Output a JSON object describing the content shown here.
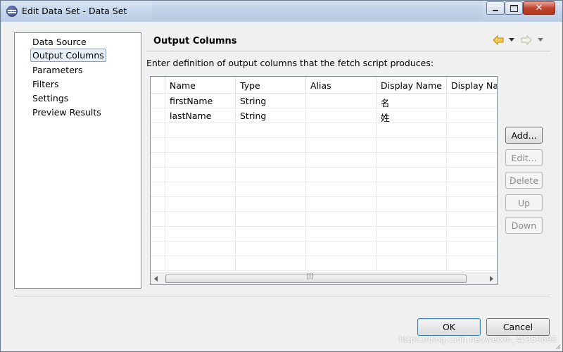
{
  "window": {
    "title": "Edit Data Set - Data Set",
    "controls": {
      "minimize": "minimize",
      "maximize": "maximize",
      "close": "✕"
    }
  },
  "nav": {
    "items": [
      {
        "label": "Data Source",
        "selected": false
      },
      {
        "label": "Output Columns",
        "selected": true
      },
      {
        "label": "Parameters",
        "selected": false
      },
      {
        "label": "Filters",
        "selected": false
      },
      {
        "label": "Settings",
        "selected": false
      },
      {
        "label": "Preview Results",
        "selected": false
      }
    ]
  },
  "page": {
    "title": "Output Columns",
    "description": "Enter definition of output columns that the fetch script produces:"
  },
  "table": {
    "columns": [
      "Name",
      "Type",
      "Alias",
      "Display Name",
      "Display Name Key"
    ],
    "rows": [
      [
        "firstName",
        "String",
        "",
        "名",
        ""
      ],
      [
        "lastName",
        "String",
        "",
        "姓",
        ""
      ]
    ],
    "empty_row_count": 10,
    "scroll_grip": "|||"
  },
  "side_buttons": [
    {
      "label": "Add...",
      "enabled": true
    },
    {
      "label": "Edit...",
      "enabled": false
    },
    {
      "label": "Delete",
      "enabled": false
    },
    {
      "label": "Up",
      "enabled": false
    },
    {
      "label": "Down",
      "enabled": false
    }
  ],
  "footer": {
    "ok_label": "OK",
    "cancel_label": "Cancel",
    "watermark": "https://blog.csdn.net/weixin_42359693"
  },
  "colors": {
    "title_bar": "#c7d8ec",
    "close_button": "#c2452e",
    "selection_border": "#7da2ce",
    "back_arrow": "#e8b422"
  }
}
